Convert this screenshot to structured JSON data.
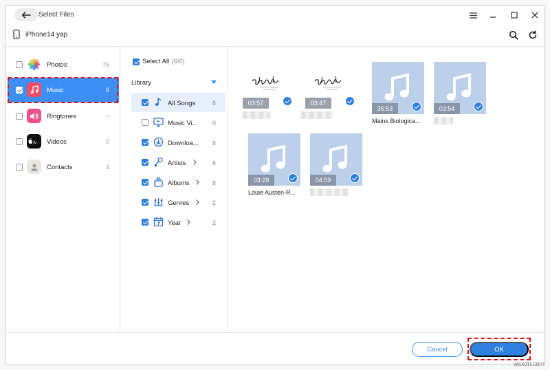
{
  "window": {
    "title": "Select Files",
    "device": "iPhone14 yap"
  },
  "categories": [
    {
      "name": "Photos",
      "count": "76",
      "checked": false,
      "icon": "photos-icon"
    },
    {
      "name": "Music",
      "count": "6",
      "checked": true,
      "icon": "music-app-icon",
      "selected": true
    },
    {
      "name": "Ringtones",
      "count": "--",
      "checked": false,
      "icon": "ringtones-icon"
    },
    {
      "name": "Videos",
      "count": "0",
      "checked": false,
      "icon": "apple-tv-icon"
    },
    {
      "name": "Contacts",
      "count": "4",
      "checked": false,
      "icon": "contacts-icon"
    }
  ],
  "library": {
    "select_all_label": "Select All",
    "select_all_count": "(6/6)",
    "section_label": "Library",
    "items": [
      {
        "label": "All Songs",
        "count": "6",
        "checked": true,
        "icon": "music-note-icon",
        "selected": true,
        "chevron": false
      },
      {
        "label": "Music Vi...",
        "count": "0",
        "checked": false,
        "icon": "music-video-icon",
        "chevron": false
      },
      {
        "label": "Downloa...",
        "count": "6",
        "checked": true,
        "icon": "download-icon",
        "chevron": false
      },
      {
        "label": "Artists",
        "count": "6",
        "checked": true,
        "icon": "artist-icon",
        "chevron": true
      },
      {
        "label": "Albums",
        "count": "6",
        "checked": true,
        "icon": "album-icon",
        "chevron": true
      },
      {
        "label": "Genres",
        "count": "2",
        "checked": true,
        "icon": "genre-icon",
        "chevron": true
      },
      {
        "label": "Year",
        "count": "2",
        "checked": true,
        "icon": "calendar-icon",
        "chevron": true
      }
    ]
  },
  "songs": [
    {
      "duration": "03:57",
      "title": "",
      "thumb": "album-art",
      "checked": true
    },
    {
      "duration": "03:47",
      "title": "",
      "thumb": "album-art",
      "checked": true
    },
    {
      "duration": "35:53",
      "title": "Mains Biologica...",
      "thumb": "music-note",
      "checked": true
    },
    {
      "duration": "03:54",
      "title": "",
      "thumb": "music-note",
      "checked": true
    },
    {
      "duration": "03:28",
      "title": "Louie Austen-R...",
      "thumb": "music-note",
      "checked": true
    },
    {
      "duration": "04:59",
      "title": "",
      "thumb": "music-note",
      "checked": true
    }
  ],
  "footer": {
    "cancel_label": "Cancel",
    "ok_label": "OK"
  },
  "watermark": "wsxdn.com",
  "colors": {
    "accent": "#2f7fe0",
    "selected_row": "#3d8ff5",
    "highlight_dash": "#dd1111"
  }
}
